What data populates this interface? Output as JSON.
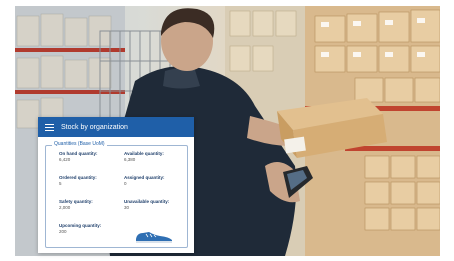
{
  "colors": {
    "header_bg": "#1f5fa8",
    "label_text": "#1f3f6b",
    "value_text": "#555555"
  },
  "card": {
    "title": "Stock by organization",
    "menu_icon": "hamburger-menu-icon",
    "panel_title": "Quantities (Base UoM)",
    "fields": [
      {
        "label": "On hand quantity:",
        "value": "6,420"
      },
      {
        "label": "Available quantity:",
        "value": "6,380"
      },
      {
        "label": "Ordered quantity:",
        "value": "5"
      },
      {
        "label": "Assigned quantity:",
        "value": "0"
      },
      {
        "label": "Safety quantity:",
        "value": "2,000"
      },
      {
        "label": "Unavailable quantity:",
        "value": "30"
      },
      {
        "label": "Upcoming quantity:",
        "value": "200"
      }
    ],
    "product_icon": "sneaker-icon"
  }
}
